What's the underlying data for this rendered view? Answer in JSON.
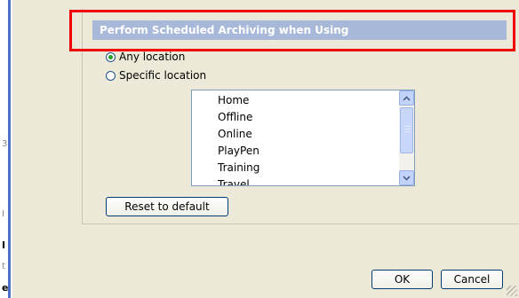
{
  "group": {
    "header": "Perform Scheduled Archiving when Using"
  },
  "location": {
    "options": [
      {
        "label": "Any location",
        "checked": true
      },
      {
        "label": "Specific location",
        "checked": false
      }
    ],
    "list_items": [
      "Home",
      "Offline",
      "Online",
      "PlayPen",
      "Training",
      "Travel"
    ]
  },
  "buttons": {
    "reset": "Reset to default",
    "ok": "OK",
    "cancel": "Cancel"
  },
  "background_fragments": [
    "3",
    "I",
    "I",
    "t",
    "e"
  ],
  "colors": {
    "header_bg": "#a8b8d8",
    "highlight": "#f00000",
    "dialog_bg": "#ece9d8"
  }
}
